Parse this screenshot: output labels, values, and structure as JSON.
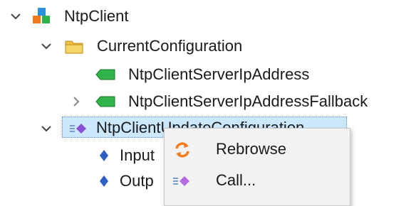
{
  "tree": {
    "root_label": "NtpClient",
    "folder_label": "CurrentConfiguration",
    "var1_label": "NtpClientServerIpAddress",
    "var2_label": "NtpClientServerIpAddressFallback",
    "method_label": "NtpClientUpdateConfiguration",
    "arg1_label": "Input",
    "arg2_label": "Outp"
  },
  "context_menu": {
    "items": [
      {
        "label": "Rebrowse",
        "icon": "refresh-icon"
      },
      {
        "label": "Call...",
        "icon": "method-icon"
      }
    ]
  },
  "colors": {
    "selection": "#cce8ff",
    "variable_green": "#2fb34a",
    "method_purple": "#8b4fd6",
    "folder_yellow": "#f4c542",
    "refresh_orange": "#f07a1a"
  }
}
